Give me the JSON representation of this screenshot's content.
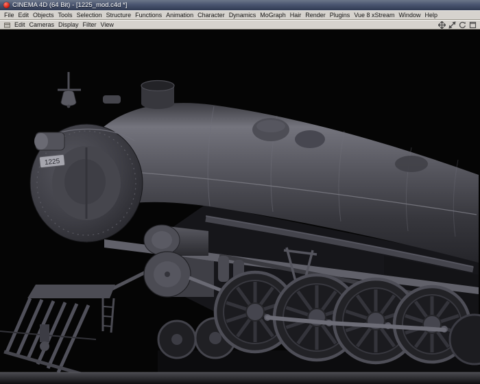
{
  "window": {
    "title": "CINEMA 4D (64 Bit) - [1225_mod.c4d *]"
  },
  "menubar": {
    "items": [
      "File",
      "Edit",
      "Objects",
      "Tools",
      "Selection",
      "Structure",
      "Functions",
      "Animation",
      "Character",
      "Dynamics",
      "MoGraph",
      "Hair",
      "Render",
      "Plugins",
      "Vue 8 xStream",
      "Window",
      "Help"
    ]
  },
  "viewport_bar": {
    "items": [
      "Edit",
      "Cameras",
      "Display",
      "Filter",
      "View"
    ],
    "icons": [
      "viewport-menu-icon",
      "move-icon",
      "zoom-icon",
      "rotate-icon",
      "maximize-icon"
    ]
  },
  "viewport": {
    "number_plate": "1225",
    "background": "#050505",
    "model": "untextured-steam-locomotive"
  },
  "colors": {
    "titlebar_top": "#6b7689",
    "titlebar_bottom": "#303a52",
    "menubar_bg": "#d6d3ce",
    "model_grey": "#4a4a50",
    "viewport_bg": "#050505"
  }
}
